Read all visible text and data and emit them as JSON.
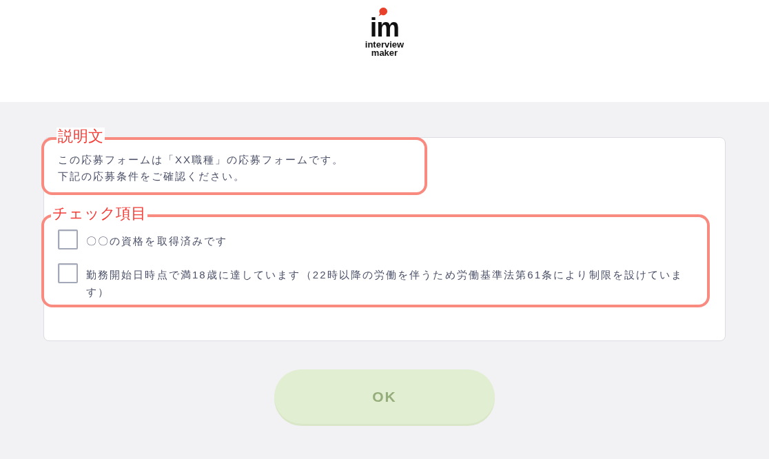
{
  "logo": {
    "mark": "im",
    "wordmark_lines": [
      "interview",
      "maker"
    ]
  },
  "form": {
    "description": {
      "annotation": "説明文",
      "lines": [
        "この応募フォームは「XX職種」の応募フォームです。",
        "下記の応募条件をご確認ください。"
      ]
    },
    "checklist": {
      "annotation": "チェック項目",
      "items": [
        {
          "label": "〇〇の資格を取得済みです",
          "checked": false
        },
        {
          "label": "勤務開始日時点で満18歳に達しています（22時以降の労働を伴うため労働基準法第61条により制限を設けています）",
          "checked": false
        }
      ]
    }
  },
  "ok_button": {
    "label": "OK",
    "disabled": true
  }
}
